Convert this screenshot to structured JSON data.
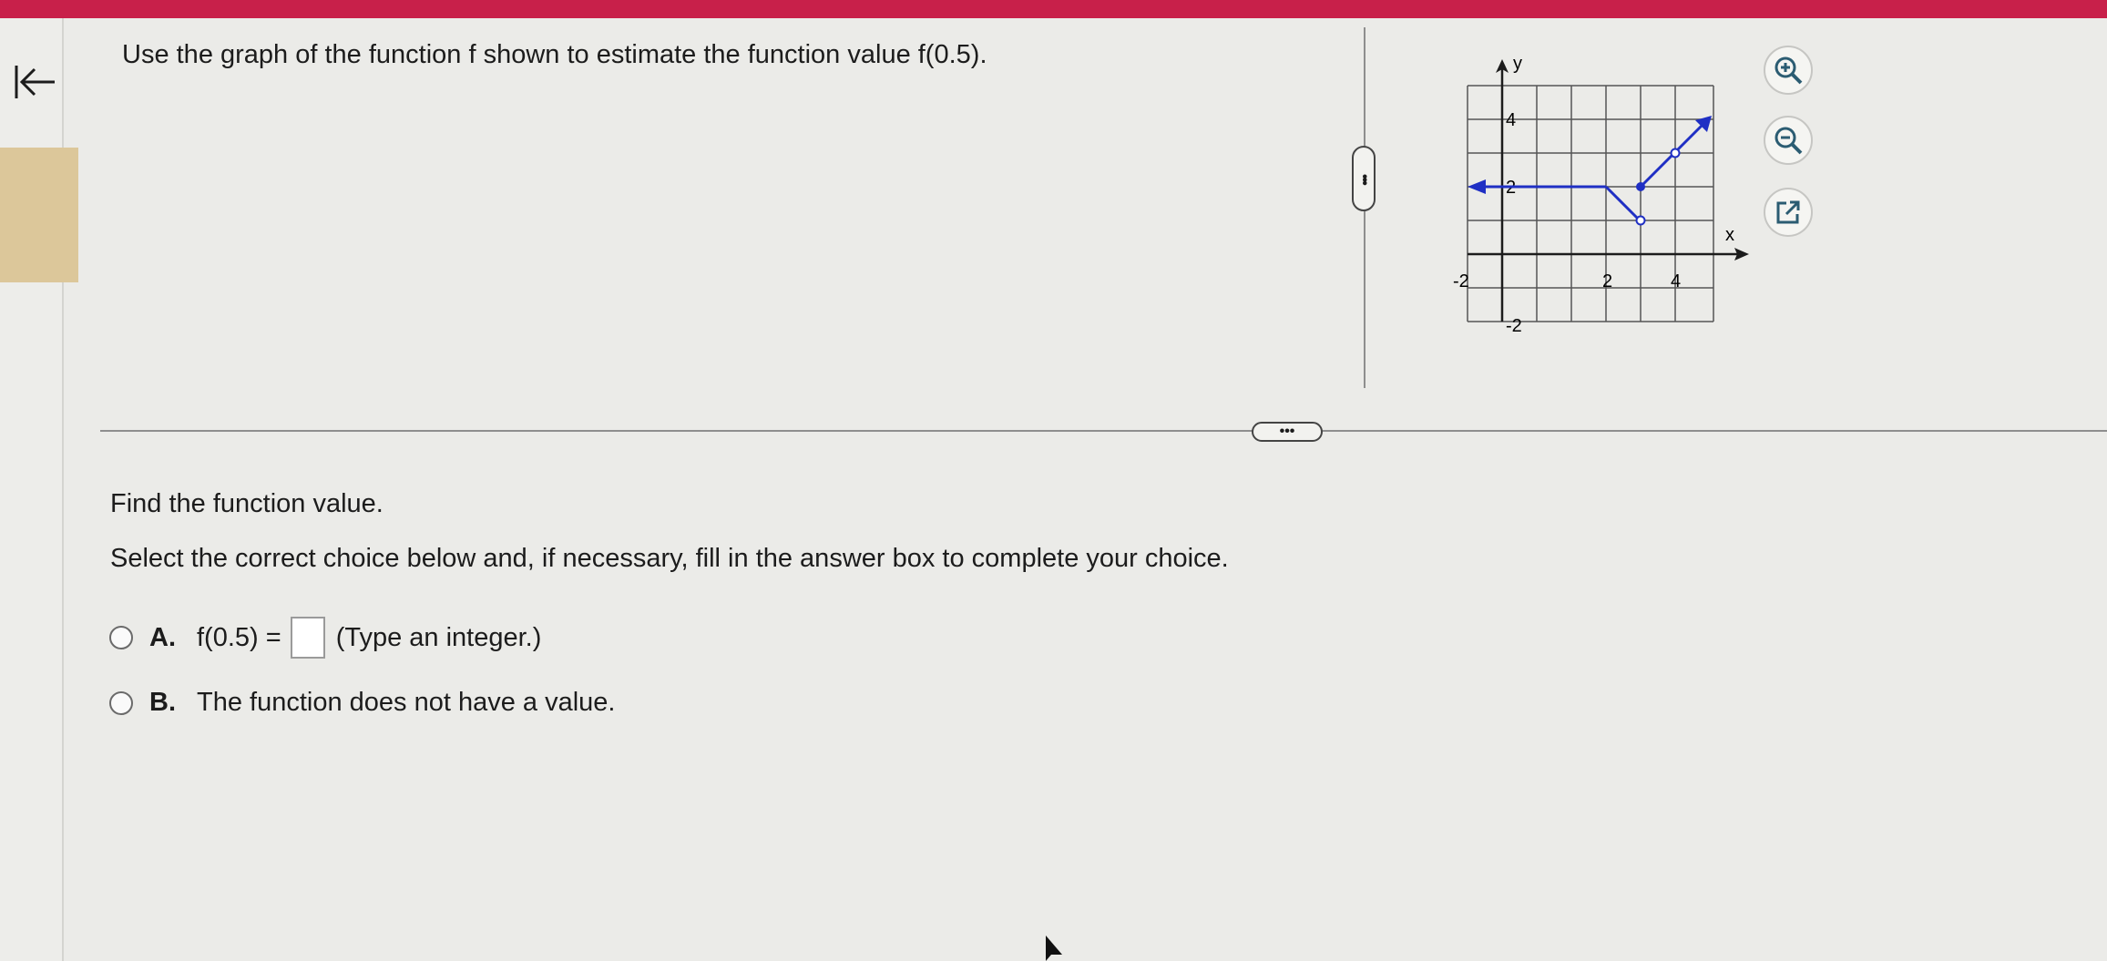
{
  "question": {
    "text": "Use the graph of the function f shown to estimate the function value f(0.5)."
  },
  "splitter": {
    "dots": "•••"
  },
  "graph": {
    "x_axis_label": "x",
    "y_axis_label": "y",
    "x_tick_labels": [
      "-2",
      "2",
      "4"
    ],
    "y_tick_labels": [
      "4",
      "2",
      "-2"
    ],
    "curve_color": "#1f2fc4",
    "axis_color": "#1c1c1c",
    "grid_color": "#555555"
  },
  "tools": {
    "zoom_in": "zoom-in-icon",
    "zoom_out": "zoom-out-icon",
    "popout": "external-link-icon",
    "icon_color": "#2b5c72"
  },
  "prompt": {
    "find": "Find the function value.",
    "instruction": "Select the correct choice below and, if necessary, fill in the answer box to complete your choice."
  },
  "choices": [
    {
      "letter": "A.",
      "prefix": "f(0.5) =",
      "answer_value": "",
      "suffix": "(Type an integer.)"
    },
    {
      "letter": "B.",
      "text": "The function does not have a value."
    }
  ]
}
